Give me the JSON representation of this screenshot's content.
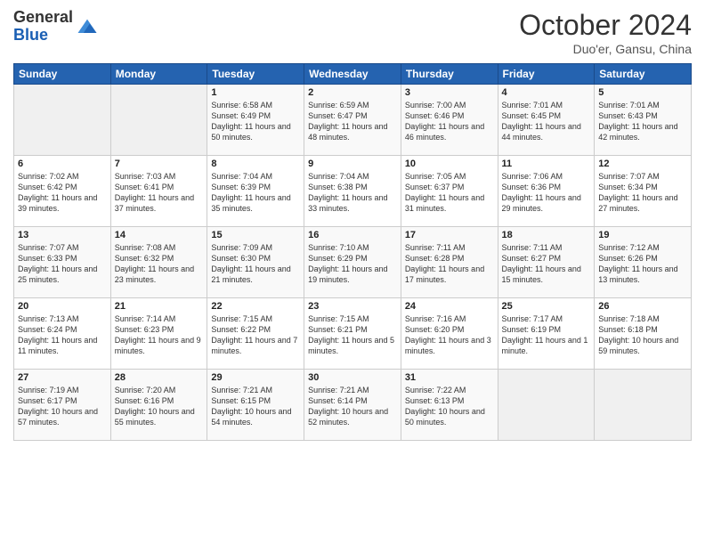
{
  "header": {
    "logo_line1": "General",
    "logo_line2": "Blue",
    "month_title": "October 2024",
    "subtitle": "Duo'er, Gansu, China"
  },
  "weekdays": [
    "Sunday",
    "Monday",
    "Tuesday",
    "Wednesday",
    "Thursday",
    "Friday",
    "Saturday"
  ],
  "weeks": [
    [
      {
        "day": "",
        "text": ""
      },
      {
        "day": "",
        "text": ""
      },
      {
        "day": "1",
        "text": "Sunrise: 6:58 AM\nSunset: 6:49 PM\nDaylight: 11 hours and 50 minutes."
      },
      {
        "day": "2",
        "text": "Sunrise: 6:59 AM\nSunset: 6:47 PM\nDaylight: 11 hours and 48 minutes."
      },
      {
        "day": "3",
        "text": "Sunrise: 7:00 AM\nSunset: 6:46 PM\nDaylight: 11 hours and 46 minutes."
      },
      {
        "day": "4",
        "text": "Sunrise: 7:01 AM\nSunset: 6:45 PM\nDaylight: 11 hours and 44 minutes."
      },
      {
        "day": "5",
        "text": "Sunrise: 7:01 AM\nSunset: 6:43 PM\nDaylight: 11 hours and 42 minutes."
      }
    ],
    [
      {
        "day": "6",
        "text": "Sunrise: 7:02 AM\nSunset: 6:42 PM\nDaylight: 11 hours and 39 minutes."
      },
      {
        "day": "7",
        "text": "Sunrise: 7:03 AM\nSunset: 6:41 PM\nDaylight: 11 hours and 37 minutes."
      },
      {
        "day": "8",
        "text": "Sunrise: 7:04 AM\nSunset: 6:39 PM\nDaylight: 11 hours and 35 minutes."
      },
      {
        "day": "9",
        "text": "Sunrise: 7:04 AM\nSunset: 6:38 PM\nDaylight: 11 hours and 33 minutes."
      },
      {
        "day": "10",
        "text": "Sunrise: 7:05 AM\nSunset: 6:37 PM\nDaylight: 11 hours and 31 minutes."
      },
      {
        "day": "11",
        "text": "Sunrise: 7:06 AM\nSunset: 6:36 PM\nDaylight: 11 hours and 29 minutes."
      },
      {
        "day": "12",
        "text": "Sunrise: 7:07 AM\nSunset: 6:34 PM\nDaylight: 11 hours and 27 minutes."
      }
    ],
    [
      {
        "day": "13",
        "text": "Sunrise: 7:07 AM\nSunset: 6:33 PM\nDaylight: 11 hours and 25 minutes."
      },
      {
        "day": "14",
        "text": "Sunrise: 7:08 AM\nSunset: 6:32 PM\nDaylight: 11 hours and 23 minutes."
      },
      {
        "day": "15",
        "text": "Sunrise: 7:09 AM\nSunset: 6:30 PM\nDaylight: 11 hours and 21 minutes."
      },
      {
        "day": "16",
        "text": "Sunrise: 7:10 AM\nSunset: 6:29 PM\nDaylight: 11 hours and 19 minutes."
      },
      {
        "day": "17",
        "text": "Sunrise: 7:11 AM\nSunset: 6:28 PM\nDaylight: 11 hours and 17 minutes."
      },
      {
        "day": "18",
        "text": "Sunrise: 7:11 AM\nSunset: 6:27 PM\nDaylight: 11 hours and 15 minutes."
      },
      {
        "day": "19",
        "text": "Sunrise: 7:12 AM\nSunset: 6:26 PM\nDaylight: 11 hours and 13 minutes."
      }
    ],
    [
      {
        "day": "20",
        "text": "Sunrise: 7:13 AM\nSunset: 6:24 PM\nDaylight: 11 hours and 11 minutes."
      },
      {
        "day": "21",
        "text": "Sunrise: 7:14 AM\nSunset: 6:23 PM\nDaylight: 11 hours and 9 minutes."
      },
      {
        "day": "22",
        "text": "Sunrise: 7:15 AM\nSunset: 6:22 PM\nDaylight: 11 hours and 7 minutes."
      },
      {
        "day": "23",
        "text": "Sunrise: 7:15 AM\nSunset: 6:21 PM\nDaylight: 11 hours and 5 minutes."
      },
      {
        "day": "24",
        "text": "Sunrise: 7:16 AM\nSunset: 6:20 PM\nDaylight: 11 hours and 3 minutes."
      },
      {
        "day": "25",
        "text": "Sunrise: 7:17 AM\nSunset: 6:19 PM\nDaylight: 11 hours and 1 minute."
      },
      {
        "day": "26",
        "text": "Sunrise: 7:18 AM\nSunset: 6:18 PM\nDaylight: 10 hours and 59 minutes."
      }
    ],
    [
      {
        "day": "27",
        "text": "Sunrise: 7:19 AM\nSunset: 6:17 PM\nDaylight: 10 hours and 57 minutes."
      },
      {
        "day": "28",
        "text": "Sunrise: 7:20 AM\nSunset: 6:16 PM\nDaylight: 10 hours and 55 minutes."
      },
      {
        "day": "29",
        "text": "Sunrise: 7:21 AM\nSunset: 6:15 PM\nDaylight: 10 hours and 54 minutes."
      },
      {
        "day": "30",
        "text": "Sunrise: 7:21 AM\nSunset: 6:14 PM\nDaylight: 10 hours and 52 minutes."
      },
      {
        "day": "31",
        "text": "Sunrise: 7:22 AM\nSunset: 6:13 PM\nDaylight: 10 hours and 50 minutes."
      },
      {
        "day": "",
        "text": ""
      },
      {
        "day": "",
        "text": ""
      }
    ]
  ]
}
